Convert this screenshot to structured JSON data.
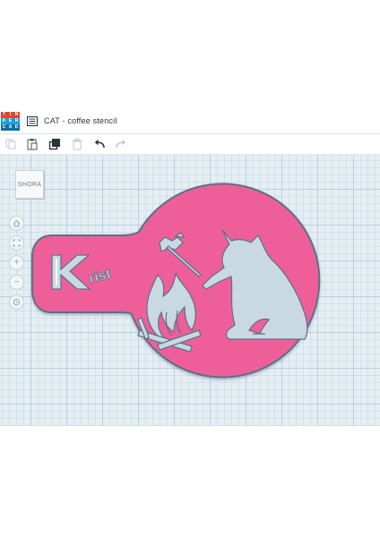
{
  "app": {
    "logo_letters": [
      "T",
      "I",
      "N",
      "K",
      "E",
      "R",
      "C",
      "A",
      "D"
    ],
    "logo_colors": [
      "#e2442f",
      "#e2442f",
      "#e2442f",
      "#1a9fd9",
      "#1a9fd9",
      "#1a9fd9",
      "#0f6f9f",
      "#0f6f9f",
      "#0f6f9f"
    ],
    "title": "CAT - coffee stencil"
  },
  "toolbar": {
    "icons": [
      "copy-icon",
      "paste-icon",
      "duplicate-icon",
      "delete-icon",
      "undo-icon",
      "redo-icon"
    ]
  },
  "viewcube": {
    "label": "SHORA"
  },
  "nav": {
    "zoom_in": "+",
    "zoom_out": "−"
  },
  "model": {
    "text": "Krist",
    "color": "#ee5f9a",
    "edge_color": "#5d6f8a"
  }
}
